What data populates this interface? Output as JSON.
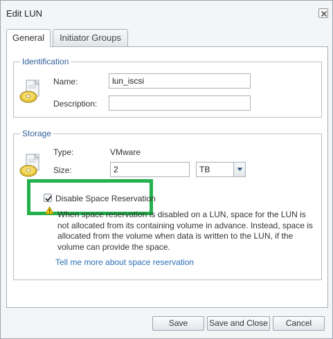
{
  "dialog": {
    "title": "Edit LUN"
  },
  "tabs": [
    {
      "label": "General",
      "active": true
    },
    {
      "label": "Initiator Groups",
      "active": false
    }
  ],
  "identification": {
    "legend": "Identification",
    "name_label": "Name:",
    "name_value": "lun_iscsi",
    "description_label": "Description:",
    "description_value": ""
  },
  "storage": {
    "legend": "Storage",
    "type_label": "Type:",
    "type_value": "VMware",
    "size_label": "Size:",
    "size_value": "2",
    "size_unit": "TB",
    "disable_space_reservation_label": "Disable Space Reservation",
    "disable_space_reservation_checked": true,
    "warning_text": "When space reservation is disabled on a LUN, space for the LUN is not allocated from its containing volume in advance. Instead, space is allocated from the volume when data is written to the LUN, if the volume can provide the space.",
    "more_link": "Tell me more about space reservation"
  },
  "buttons": {
    "save": "Save",
    "save_and_close": "Save and Close",
    "cancel": "Cancel"
  },
  "colors": {
    "legend": "#2f5f9a",
    "link": "#2c6fb5",
    "highlight": "#22b14c",
    "warning": "#f2c200"
  }
}
